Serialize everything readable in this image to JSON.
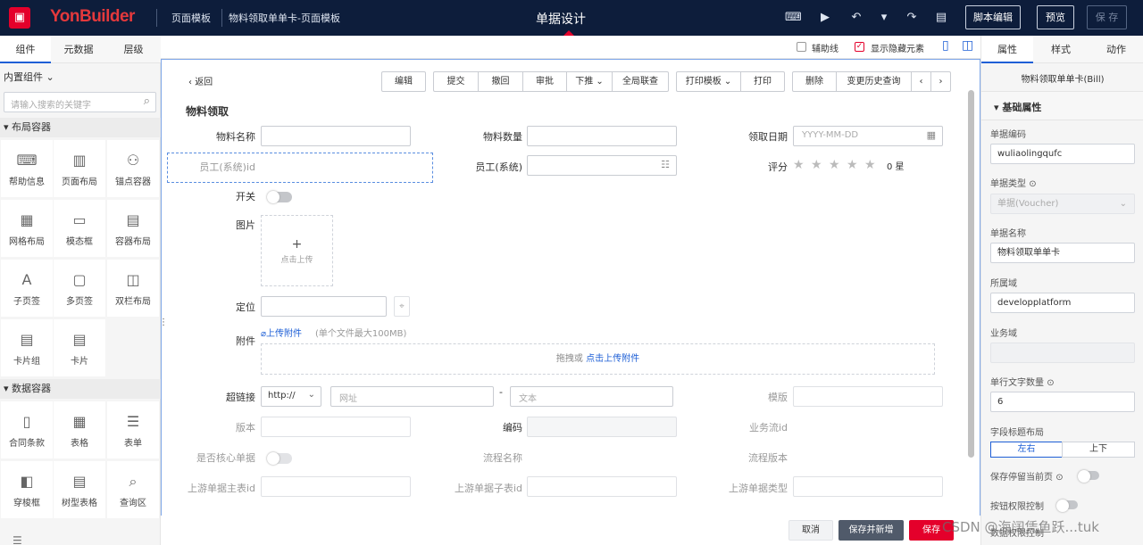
{
  "topbar": {
    "brand": "YonBuilder",
    "crumb1": "页面模板",
    "crumb2": "物料领取单单卡-页面模板",
    "center_title": "单据设计",
    "script_edit": "脚本编辑",
    "preview": "预览",
    "save": "保 存"
  },
  "left": {
    "tabs": [
      "组件",
      "元数据",
      "层级"
    ],
    "builtin": "内置组件",
    "search_placeholder": "请输入搜索的关键字",
    "group1": "布局容器",
    "group2": "数据容器",
    "components1": [
      {
        "label": "帮助信息",
        "icon": "help-info-icon",
        "glyph": "⌨"
      },
      {
        "label": "页面布局",
        "icon": "page-layout-icon",
        "glyph": "▥"
      },
      {
        "label": "锚点容器",
        "icon": "anchor-container-icon",
        "glyph": "⚇"
      },
      {
        "label": "网格布局",
        "icon": "grid-layout-icon",
        "glyph": "▦"
      },
      {
        "label": "模态框",
        "icon": "modal-icon",
        "glyph": "▭"
      },
      {
        "label": "容器布局",
        "icon": "container-layout-icon",
        "glyph": "▤"
      },
      {
        "label": "子页签",
        "icon": "subtab-icon",
        "glyph": "A"
      },
      {
        "label": "多页签",
        "icon": "multi-tab-icon",
        "glyph": "▢"
      },
      {
        "label": "双栏布局",
        "icon": "two-column-icon",
        "glyph": "◫"
      },
      {
        "label": "卡片组",
        "icon": "card-group-icon",
        "glyph": "▤"
      },
      {
        "label": "卡片",
        "icon": "card-icon",
        "glyph": "▤"
      }
    ],
    "components2": [
      {
        "label": "合同条款",
        "icon": "contract-icon",
        "glyph": "▯"
      },
      {
        "label": "表格",
        "icon": "table-icon",
        "glyph": "▦"
      },
      {
        "label": "表单",
        "icon": "form-icon",
        "glyph": "☰"
      },
      {
        "label": "穿梭框",
        "icon": "transfer-icon",
        "glyph": "◧"
      },
      {
        "label": "树型表格",
        "icon": "tree-table-icon",
        "glyph": "▤"
      },
      {
        "label": "查询区",
        "icon": "query-area-icon",
        "glyph": "⌕"
      }
    ]
  },
  "canvas": {
    "aux_line": "辅助线",
    "show_hidden": "显示隐藏元素",
    "back": "返回",
    "section_title": "物料领取",
    "actions": [
      "编辑",
      "提交",
      "撤回",
      "审批",
      "下推",
      "全局联查",
      "打印模板",
      "打印",
      "删除",
      "变更历史查询"
    ],
    "fields": {
      "material_name": "物料名称",
      "material_qty": "物料数量",
      "receive_date": "领取日期",
      "date_placeholder": "YYYY-MM-DD",
      "employee_id": "员工(系统)id",
      "employee": "员工(系统)",
      "rating": "评分",
      "rating_value": "0 星",
      "switch": "开关",
      "image": "图片",
      "upload_click": "点击上传",
      "location": "定位",
      "attachment": "附件",
      "upload_attachment": "上传附件",
      "attachment_hint": "(单个文件最大100MB)",
      "drag_text": "拖拽或",
      "drag_link": "点击上传附件",
      "hyperlink": "超链接",
      "protocol": "http://",
      "url_placeholder": "网址",
      "dash": "-",
      "text_placeholder": "文本",
      "template": "模版",
      "version": "版本",
      "code": "编码",
      "bizflow_id": "业务流id",
      "is_core": "是否核心单据",
      "flow_name": "流程名称",
      "flow_version": "流程版本",
      "up_main_id": "上游单据主表id",
      "up_sub_id": "上游单据子表id",
      "up_type": "上游单据类型"
    },
    "footer": {
      "cancel": "取消",
      "save_new": "保存并新增",
      "save": "保存"
    }
  },
  "right": {
    "tabs": [
      "属性",
      "样式",
      "动作"
    ],
    "entity": "物料领取单单卡(Bill)",
    "basic": "基础属性",
    "bill_code_label": "单据编码",
    "bill_code": "wuliaolingqufc",
    "bill_type_label": "单据类型",
    "bill_type": "单据(Voucher)",
    "bill_name_label": "单据名称",
    "bill_name": "物料领取单单卡",
    "domain_label": "所属域",
    "domain": "developplatform",
    "biz_domain_label": "业务域",
    "biz_domain": "",
    "text_count_label": "单行文字数量",
    "text_count": "6",
    "title_layout_label": "字段标题布局",
    "layout_lr": "左右",
    "layout_tb": "上下",
    "stay_page_label": "保存停留当前页",
    "perm_label": "按钮权限控制",
    "more_label": "数据权限控制"
  },
  "watermark": "CSDN @海阔凭鱼跃...tuk"
}
